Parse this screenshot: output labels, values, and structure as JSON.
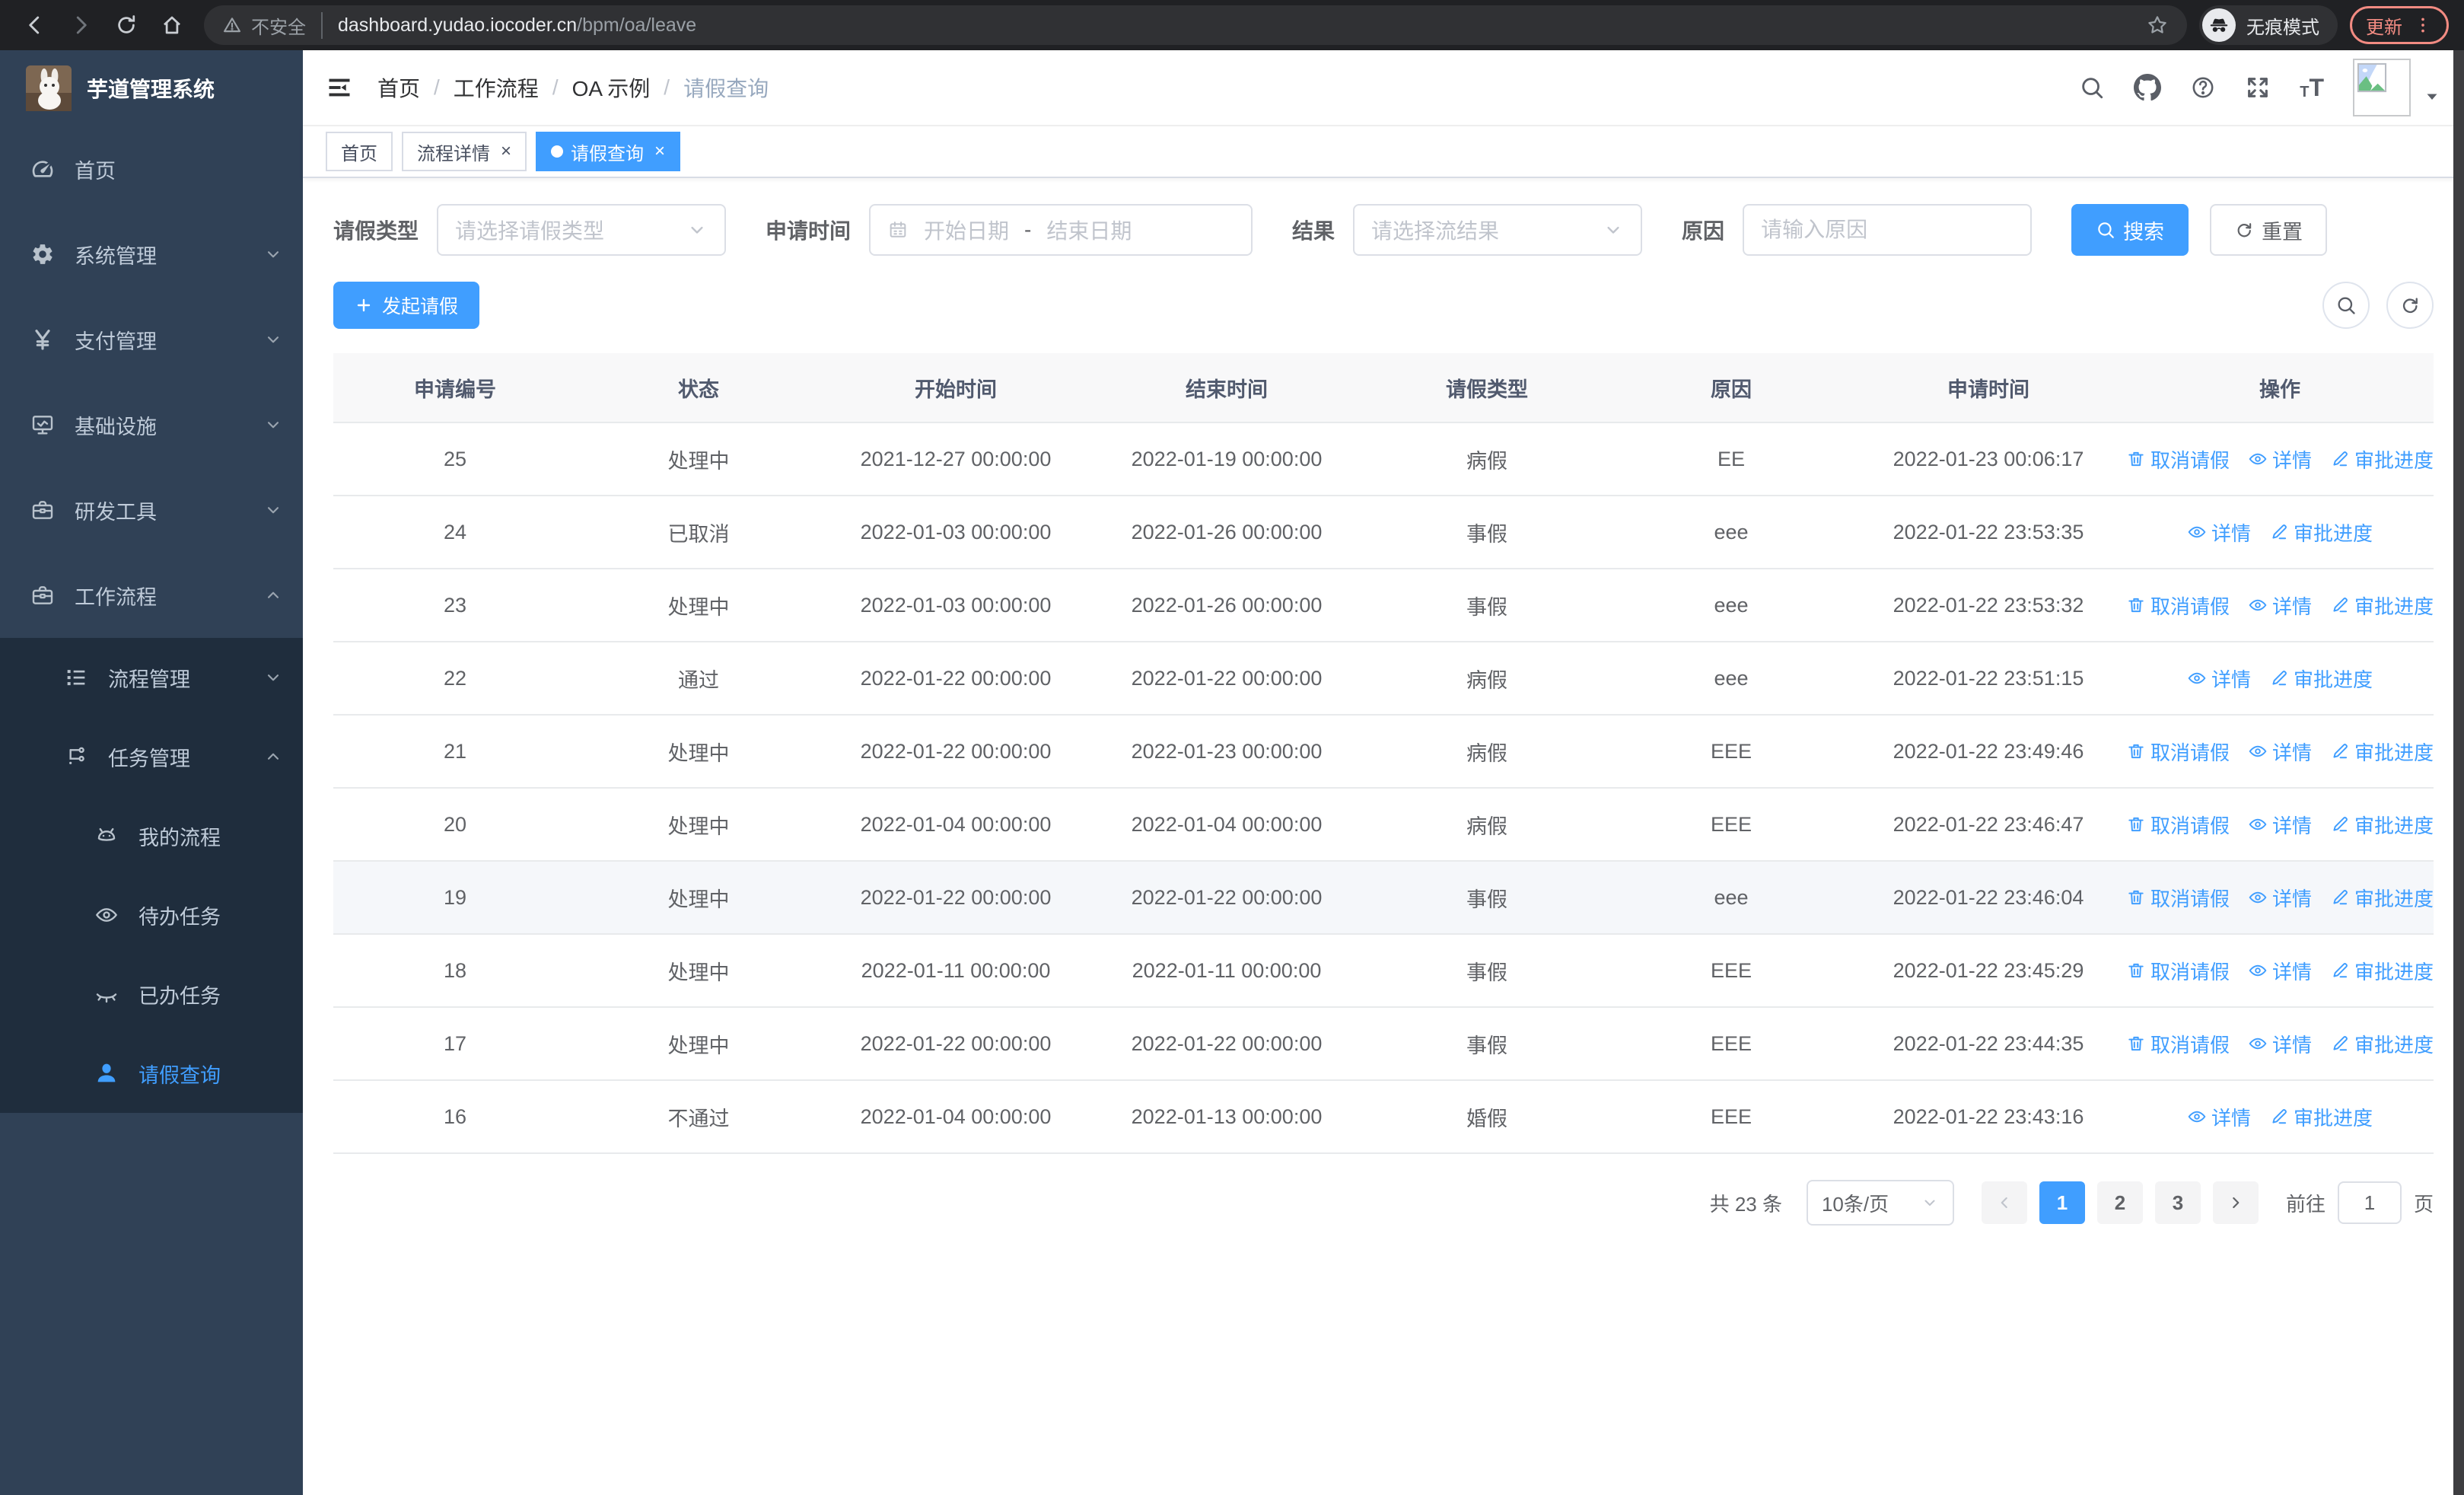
{
  "browser": {
    "security_label": "不安全",
    "url_host": "dashboard.yudao.iocoder.cn",
    "url_path": "/bpm/oa/leave",
    "incognito_label": "无痕模式",
    "update_label": "更新"
  },
  "sidebar": {
    "title": "芋道管理系统",
    "menu": [
      {
        "label": "首页",
        "icon": "dashboard",
        "level": 1,
        "chevron": "",
        "group": "root",
        "active": false
      },
      {
        "label": "系统管理",
        "icon": "gear",
        "level": 1,
        "chevron": "down",
        "group": "root",
        "active": false
      },
      {
        "label": "支付管理",
        "icon": "yen",
        "level": 1,
        "chevron": "down",
        "group": "root",
        "active": false
      },
      {
        "label": "基础设施",
        "icon": "monitor",
        "level": 1,
        "chevron": "down",
        "group": "root",
        "active": false
      },
      {
        "label": "研发工具",
        "icon": "toolbox",
        "level": 1,
        "chevron": "down",
        "group": "root",
        "active": false
      },
      {
        "label": "工作流程",
        "icon": "briefcase",
        "level": 1,
        "chevron": "up",
        "group": "root",
        "active": false
      },
      {
        "label": "流程管理",
        "icon": "tree-list",
        "level": 2,
        "chevron": "down",
        "group": "sub",
        "active": false
      },
      {
        "label": "任务管理",
        "icon": "flow",
        "level": 2,
        "chevron": "up",
        "group": "sub",
        "active": false
      },
      {
        "label": "我的流程",
        "icon": "robot",
        "level": 3,
        "chevron": "",
        "group": "sub",
        "active": false
      },
      {
        "label": "待办任务",
        "icon": "eye-open",
        "level": 3,
        "chevron": "",
        "group": "sub",
        "active": false
      },
      {
        "label": "已办任务",
        "icon": "eye-closed",
        "level": 3,
        "chevron": "",
        "group": "sub",
        "active": false
      },
      {
        "label": "请假查询",
        "icon": "user",
        "level": 3,
        "chevron": "",
        "group": "sub",
        "active": true
      }
    ]
  },
  "breadcrumb": [
    "首页",
    "工作流程",
    "OA 示例",
    "请假查询"
  ],
  "tabs": [
    {
      "label": "首页",
      "closable": false,
      "active": false
    },
    {
      "label": "流程详情",
      "closable": true,
      "active": false
    },
    {
      "label": "请假查询",
      "closable": true,
      "active": true
    }
  ],
  "filters": {
    "leave_type": {
      "label": "请假类型",
      "placeholder": "请选择请假类型"
    },
    "apply_time": {
      "label": "申请时间",
      "start_placeholder": "开始日期",
      "separator": "-",
      "end_placeholder": "结束日期"
    },
    "result": {
      "label": "结果",
      "placeholder": "请选择流结果"
    },
    "reason": {
      "label": "原因",
      "placeholder": "请输入原因"
    },
    "search_label": "搜索",
    "reset_label": "重置"
  },
  "toolbar": {
    "create_label": "发起请假"
  },
  "table": {
    "columns": [
      "申请编号",
      "状态",
      "开始时间",
      "结束时间",
      "请假类型",
      "原因",
      "申请时间",
      "操作"
    ],
    "action_labels": {
      "cancel": "取消请假",
      "detail": "详情",
      "progress": "审批进度"
    },
    "rows": [
      {
        "id": "25",
        "status": "处理中",
        "start": "2021-12-27 00:00:00",
        "end": "2022-01-19 00:00:00",
        "type": "病假",
        "reason": "EE",
        "apply_time": "2022-01-23 00:06:17",
        "actions": [
          "cancel",
          "detail",
          "progress"
        ],
        "highlighted": false
      },
      {
        "id": "24",
        "status": "已取消",
        "start": "2022-01-03 00:00:00",
        "end": "2022-01-26 00:00:00",
        "type": "事假",
        "reason": "eee",
        "apply_time": "2022-01-22 23:53:35",
        "actions": [
          "detail",
          "progress"
        ],
        "highlighted": false
      },
      {
        "id": "23",
        "status": "处理中",
        "start": "2022-01-03 00:00:00",
        "end": "2022-01-26 00:00:00",
        "type": "事假",
        "reason": "eee",
        "apply_time": "2022-01-22 23:53:32",
        "actions": [
          "cancel",
          "detail",
          "progress"
        ],
        "highlighted": false
      },
      {
        "id": "22",
        "status": "通过",
        "start": "2022-01-22 00:00:00",
        "end": "2022-01-22 00:00:00",
        "type": "病假",
        "reason": "eee",
        "apply_time": "2022-01-22 23:51:15",
        "actions": [
          "detail",
          "progress"
        ],
        "highlighted": false
      },
      {
        "id": "21",
        "status": "处理中",
        "start": "2022-01-22 00:00:00",
        "end": "2022-01-23 00:00:00",
        "type": "病假",
        "reason": "EEE",
        "apply_time": "2022-01-22 23:49:46",
        "actions": [
          "cancel",
          "detail",
          "progress"
        ],
        "highlighted": false
      },
      {
        "id": "20",
        "status": "处理中",
        "start": "2022-01-04 00:00:00",
        "end": "2022-01-04 00:00:00",
        "type": "病假",
        "reason": "EEE",
        "apply_time": "2022-01-22 23:46:47",
        "actions": [
          "cancel",
          "detail",
          "progress"
        ],
        "highlighted": false
      },
      {
        "id": "19",
        "status": "处理中",
        "start": "2022-01-22 00:00:00",
        "end": "2022-01-22 00:00:00",
        "type": "事假",
        "reason": "eee",
        "apply_time": "2022-01-22 23:46:04",
        "actions": [
          "cancel",
          "detail",
          "progress"
        ],
        "highlighted": true
      },
      {
        "id": "18",
        "status": "处理中",
        "start": "2022-01-11 00:00:00",
        "end": "2022-01-11 00:00:00",
        "type": "事假",
        "reason": "EEE",
        "apply_time": "2022-01-22 23:45:29",
        "actions": [
          "cancel",
          "detail",
          "progress"
        ],
        "highlighted": false
      },
      {
        "id": "17",
        "status": "处理中",
        "start": "2022-01-22 00:00:00",
        "end": "2022-01-22 00:00:00",
        "type": "事假",
        "reason": "EEE",
        "apply_time": "2022-01-22 23:44:35",
        "actions": [
          "cancel",
          "detail",
          "progress"
        ],
        "highlighted": false
      },
      {
        "id": "16",
        "status": "不通过",
        "start": "2022-01-04 00:00:00",
        "end": "2022-01-13 00:00:00",
        "type": "婚假",
        "reason": "EEE",
        "apply_time": "2022-01-22 23:43:16",
        "actions": [
          "detail",
          "progress"
        ],
        "highlighted": false
      }
    ]
  },
  "pagination": {
    "total_text": "共 23 条",
    "page_size": "10条/页",
    "pages": [
      "1",
      "2",
      "3"
    ],
    "active_page": "1",
    "goto_label": "前往",
    "goto_value": "1",
    "page_suffix": "页"
  },
  "colors": {
    "accent": "#409eff",
    "sidebar_bg": "#304156",
    "submenu_bg": "#1f2d3d"
  }
}
